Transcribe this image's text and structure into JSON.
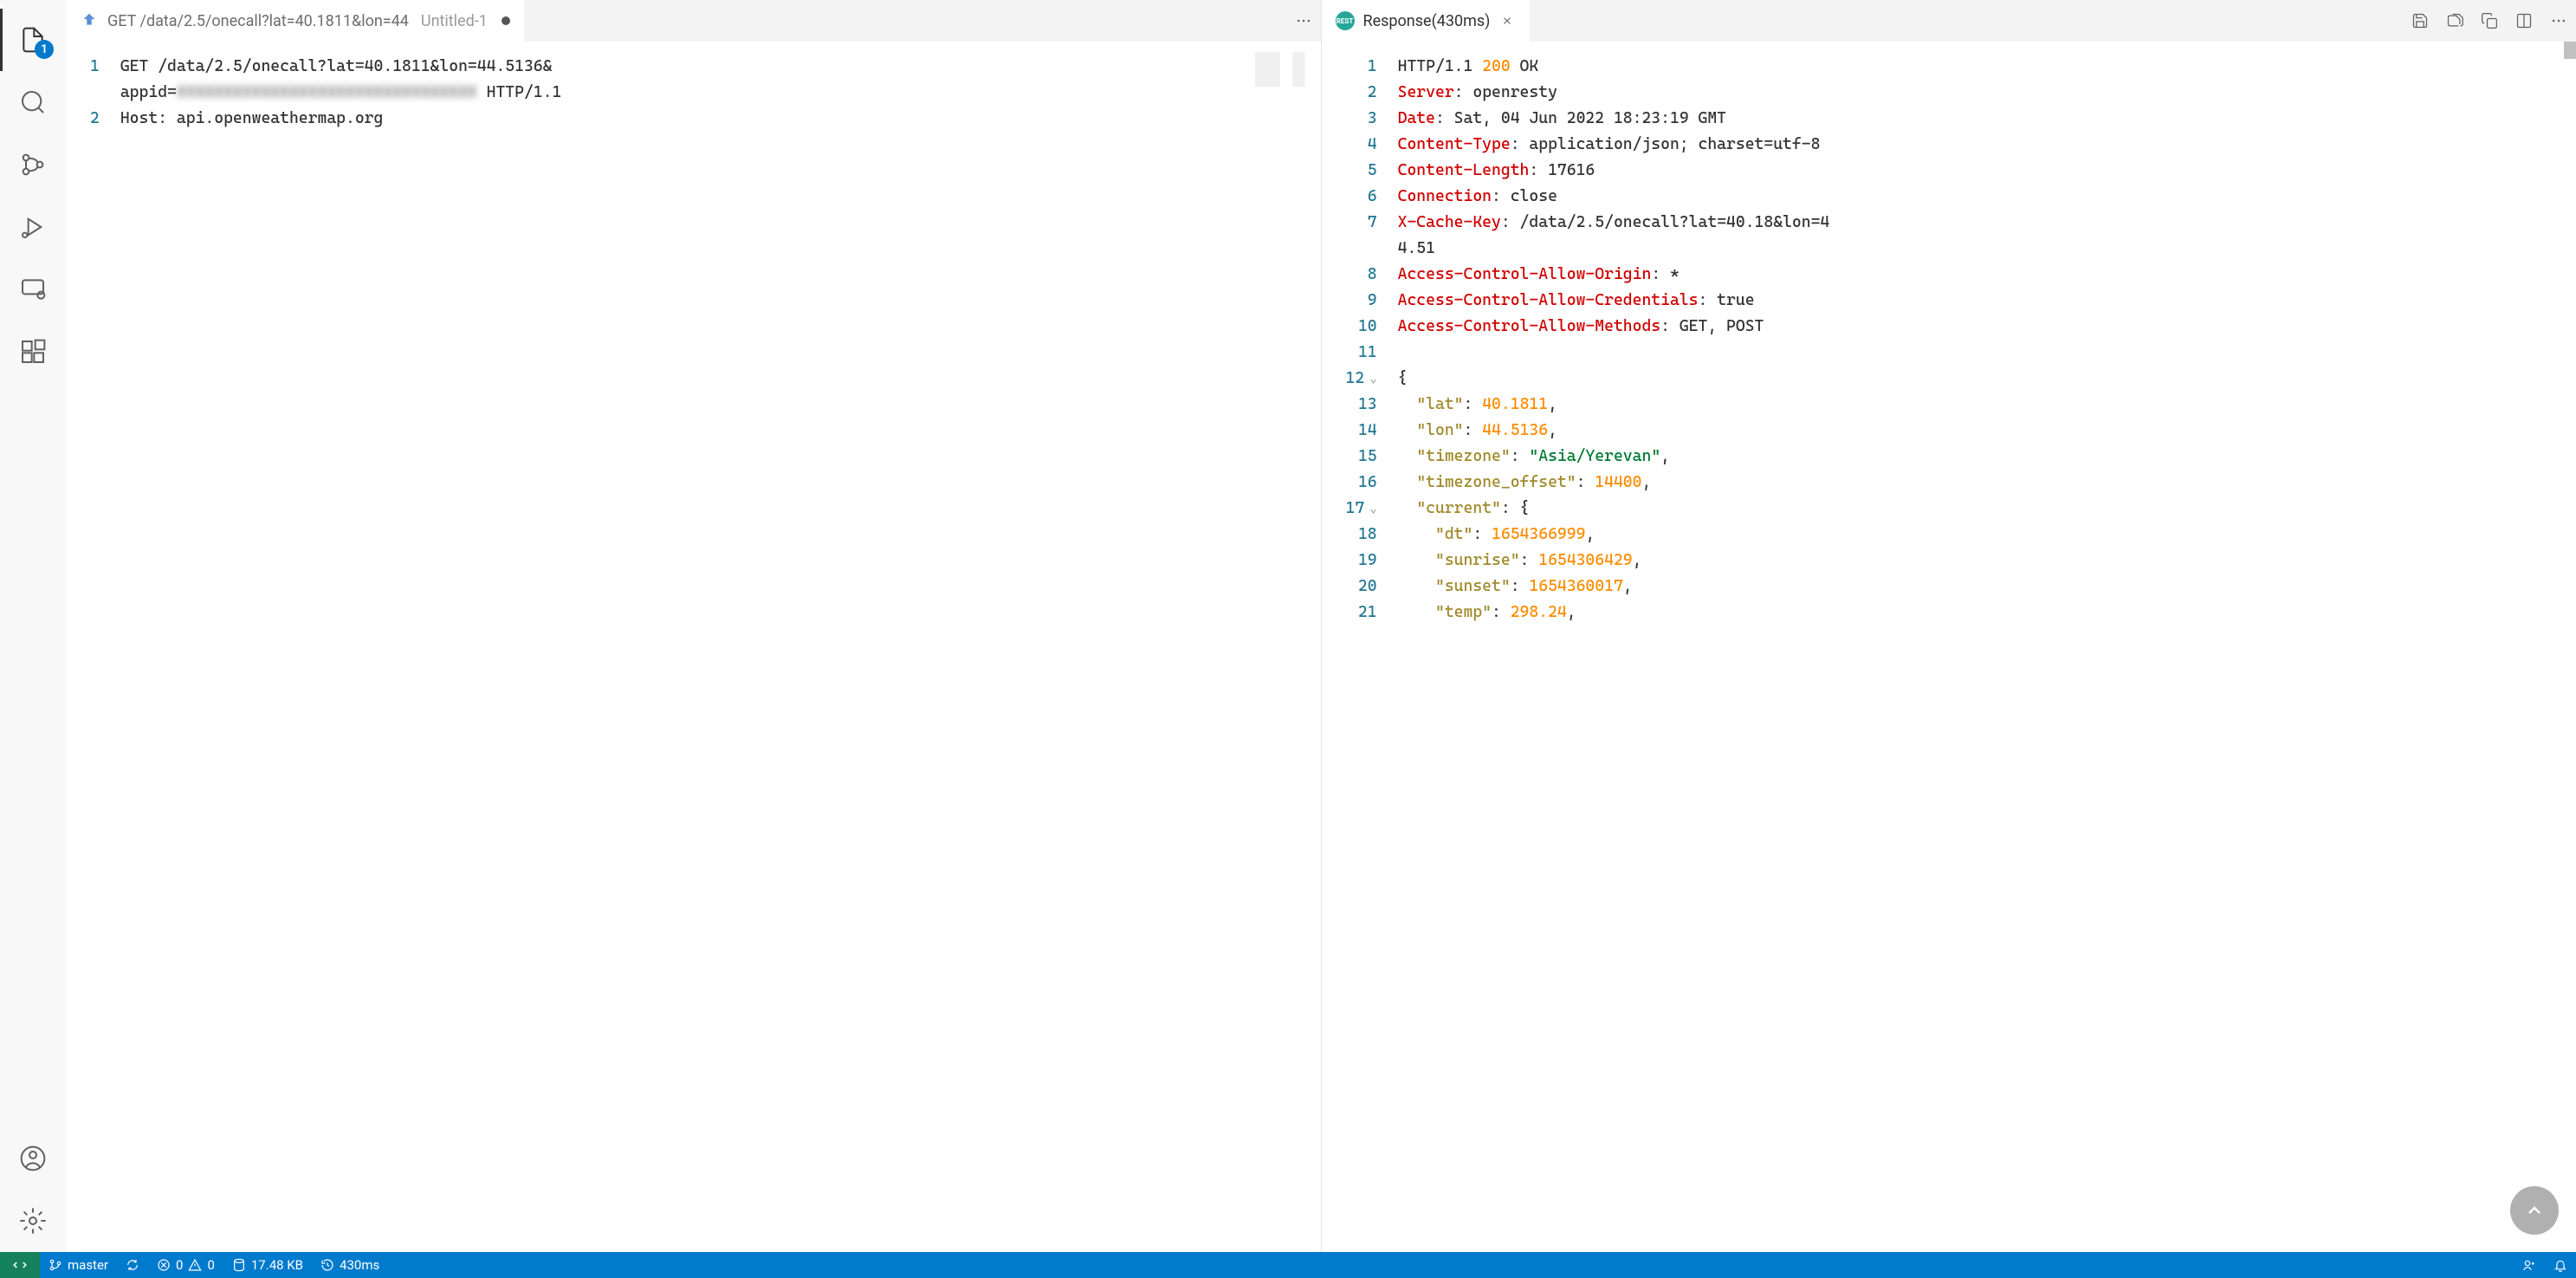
{
  "activity_bar": {
    "badge_count": "1"
  },
  "tabs": {
    "left": {
      "title": "GET /data/2.5/onecall?lat=40.1811&lon=44",
      "untitled": "Untitled-1"
    },
    "right": {
      "title": "Response(430ms)"
    }
  },
  "request_editor": {
    "line1_prefix": "GET /data/2.5/onecall?lat=40.1811&lon=44.5136&",
    "line1_appid": "appid=",
    "line1_blurred": "XXXXXXXXXXXXXXXXXXXXXXXXXXXXXXXX",
    "line1_http": " HTTP/1.1",
    "line2_host": "Host: api.openweathermap.org"
  },
  "response_editor": {
    "lines": [
      {
        "n": "1",
        "segments": [
          {
            "t": "HTTP/1.1 ",
            "c": "plain"
          },
          {
            "t": "200",
            "c": "http-status"
          },
          {
            "t": " OK",
            "c": "plain"
          }
        ]
      },
      {
        "n": "2",
        "segments": [
          {
            "t": "Server",
            "c": "header-key"
          },
          {
            "t": ": openresty",
            "c": "plain"
          }
        ]
      },
      {
        "n": "3",
        "segments": [
          {
            "t": "Date",
            "c": "header-key"
          },
          {
            "t": ": Sat, 04 Jun 2022 18:23:19 GMT",
            "c": "plain"
          }
        ]
      },
      {
        "n": "4",
        "segments": [
          {
            "t": "Content-Type",
            "c": "header-key"
          },
          {
            "t": ": application/json; charset=utf-8",
            "c": "plain"
          }
        ]
      },
      {
        "n": "5",
        "segments": [
          {
            "t": "Content-Length",
            "c": "header-key"
          },
          {
            "t": ": 17616",
            "c": "plain"
          }
        ]
      },
      {
        "n": "6",
        "segments": [
          {
            "t": "Connection",
            "c": "header-key"
          },
          {
            "t": ": close",
            "c": "plain"
          }
        ]
      },
      {
        "n": "7",
        "segments": [
          {
            "t": "X-Cache-Key",
            "c": "header-key"
          },
          {
            "t": ": /data/2.5/onecall?lat=40.18&lon=4",
            "c": "plain"
          }
        ]
      },
      {
        "n": "",
        "segments": [
          {
            "t": "4.51",
            "c": "plain"
          }
        ]
      },
      {
        "n": "8",
        "segments": [
          {
            "t": "Access-Control-Allow-Origin",
            "c": "header-key"
          },
          {
            "t": ": *",
            "c": "plain"
          }
        ]
      },
      {
        "n": "9",
        "segments": [
          {
            "t": "Access-Control-Allow-Credentials",
            "c": "header-key"
          },
          {
            "t": ": true",
            "c": "plain"
          }
        ]
      },
      {
        "n": "10",
        "segments": [
          {
            "t": "Access-Control-Allow-Methods",
            "c": "header-key"
          },
          {
            "t": ": GET, POST",
            "c": "plain"
          }
        ]
      },
      {
        "n": "11",
        "segments": []
      },
      {
        "n": "12",
        "fold": true,
        "segments": [
          {
            "t": "{",
            "c": "plain"
          }
        ]
      },
      {
        "n": "13",
        "segments": [
          {
            "t": "  ",
            "c": "plain"
          },
          {
            "t": "\"lat\"",
            "c": "json-key"
          },
          {
            "t": ": ",
            "c": "plain"
          },
          {
            "t": "40.1811",
            "c": "json-number"
          },
          {
            "t": ",",
            "c": "plain"
          }
        ]
      },
      {
        "n": "14",
        "segments": [
          {
            "t": "  ",
            "c": "plain"
          },
          {
            "t": "\"lon\"",
            "c": "json-key"
          },
          {
            "t": ": ",
            "c": "plain"
          },
          {
            "t": "44.5136",
            "c": "json-number"
          },
          {
            "t": ",",
            "c": "plain"
          }
        ]
      },
      {
        "n": "15",
        "segments": [
          {
            "t": "  ",
            "c": "plain"
          },
          {
            "t": "\"timezone\"",
            "c": "json-key"
          },
          {
            "t": ": ",
            "c": "plain"
          },
          {
            "t": "\"Asia/Yerevan\"",
            "c": "json-string"
          },
          {
            "t": ",",
            "c": "plain"
          }
        ]
      },
      {
        "n": "16",
        "segments": [
          {
            "t": "  ",
            "c": "plain"
          },
          {
            "t": "\"timezone_offset\"",
            "c": "json-key"
          },
          {
            "t": ": ",
            "c": "plain"
          },
          {
            "t": "14400",
            "c": "json-number"
          },
          {
            "t": ",",
            "c": "plain"
          }
        ]
      },
      {
        "n": "17",
        "fold": true,
        "segments": [
          {
            "t": "  ",
            "c": "plain"
          },
          {
            "t": "\"current\"",
            "c": "json-key"
          },
          {
            "t": ": {",
            "c": "plain"
          }
        ]
      },
      {
        "n": "18",
        "segments": [
          {
            "t": "    ",
            "c": "plain"
          },
          {
            "t": "\"dt\"",
            "c": "json-key"
          },
          {
            "t": ": ",
            "c": "plain"
          },
          {
            "t": "1654366999",
            "c": "json-number"
          },
          {
            "t": ",",
            "c": "plain"
          }
        ]
      },
      {
        "n": "19",
        "segments": [
          {
            "t": "    ",
            "c": "plain"
          },
          {
            "t": "\"sunrise\"",
            "c": "json-key"
          },
          {
            "t": ": ",
            "c": "plain"
          },
          {
            "t": "1654306429",
            "c": "json-number"
          },
          {
            "t": ",",
            "c": "plain"
          }
        ]
      },
      {
        "n": "20",
        "segments": [
          {
            "t": "    ",
            "c": "plain"
          },
          {
            "t": "\"sunset\"",
            "c": "json-key"
          },
          {
            "t": ": ",
            "c": "plain"
          },
          {
            "t": "1654360017",
            "c": "json-number"
          },
          {
            "t": ",",
            "c": "plain"
          }
        ]
      },
      {
        "n": "21",
        "segments": [
          {
            "t": "    ",
            "c": "plain"
          },
          {
            "t": "\"temp\"",
            "c": "json-key"
          },
          {
            "t": ": ",
            "c": "plain"
          },
          {
            "t": "298.24",
            "c": "json-number"
          },
          {
            "t": ",",
            "c": "plain"
          }
        ]
      }
    ]
  },
  "status_bar": {
    "branch": "master",
    "errors": "0",
    "warnings": "0",
    "size": "17.48 KB",
    "time": "430ms"
  }
}
